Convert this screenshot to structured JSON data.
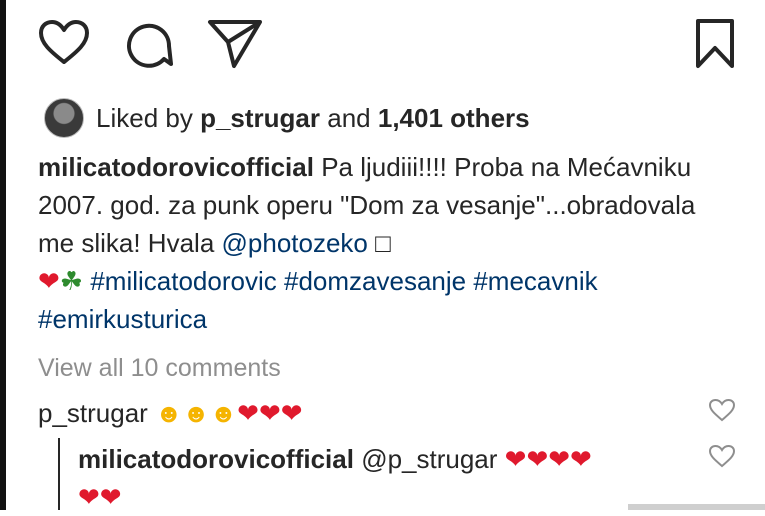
{
  "post": {
    "likes": {
      "prefix": "Liked by",
      "user": "p_strugar",
      "conjunction": "and",
      "count": "1,401 others"
    },
    "caption": {
      "username": "milicatodorovicofficial",
      "text": "Pa ljudiii!!!! Proba na Mećavniku 2007. god. za punk operu \"Dom za vesanje\"...obradovala me slika! Hvala",
      "mention": "@photozeko",
      "trailing_char": "□",
      "emoji_hearts": "❤",
      "emoji_clover": "☘",
      "hashtags": [
        "#milicatodorovic",
        "#domzavesanje",
        "#mecavnik",
        "#emirkusturica"
      ]
    },
    "view_all_comments": "View all 10 comments",
    "comments": [
      {
        "username": "p_strugar",
        "smileys": "☻☻☻",
        "hearts": "❤❤❤"
      }
    ],
    "reply": {
      "username": "milicatodorovicofficial",
      "mention": "@p_strugar",
      "hearts_line1": "❤❤❤❤",
      "hearts_line2": "❤❤"
    }
  },
  "icons": {
    "like": "heart-outline-icon",
    "comment": "speech-bubble-icon",
    "share": "paper-plane-icon",
    "save": "bookmark-icon",
    "avatar": "user-avatar",
    "comment_like": "small-heart-outline-icon"
  },
  "colors": {
    "text": "#262626",
    "hashtag": "#003569",
    "muted": "#8e8e8e",
    "heart": "#e0192d"
  }
}
